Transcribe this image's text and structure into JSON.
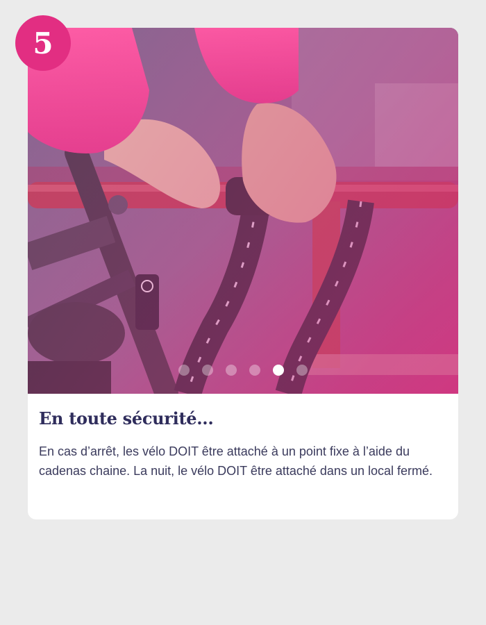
{
  "step": {
    "number": "5",
    "color": "#e22e82"
  },
  "card": {
    "image": {
      "description_icon": "bike-chain-lock-photo"
    },
    "carousel": {
      "count": 6,
      "active_index": 4
    },
    "title": "En toute sécurité...",
    "text": "En cas d’arrêt, les vélo DOIT être attaché à un point fixe à l’aide du cadenas chaine. La nuit, le vélo DOIT être attaché dans un local fermé."
  },
  "colors": {
    "title": "#2f2d5c",
    "text": "#3a3a5c",
    "background": "#ebebeb"
  }
}
